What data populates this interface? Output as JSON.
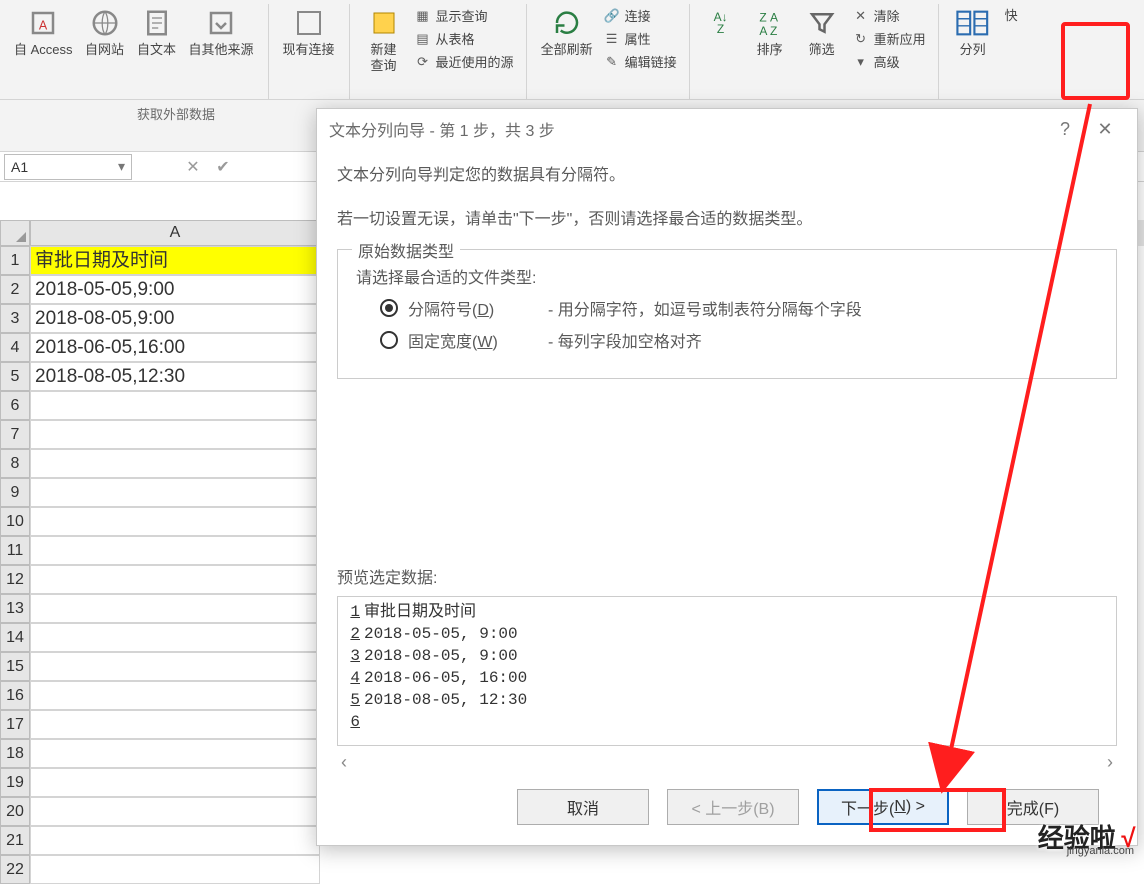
{
  "ribbon": {
    "get_external": {
      "access": "自 Access",
      "web": "自网站",
      "text": "自文本",
      "other": "自其他来源",
      "existing": "现有连接",
      "group_label": "获取外部数据"
    },
    "query": {
      "new_query": "新建\n查询",
      "show_query": "显示查询",
      "from_table": "从表格",
      "recent": "最近使用的源"
    },
    "connections": {
      "refresh_all": "全部刷新",
      "connections": "连接",
      "properties": "属性",
      "edit_links": "编辑链接"
    },
    "sort_filter": {
      "sort": "排序",
      "filter": "筛选",
      "clear": "清除",
      "reapply": "重新应用",
      "advanced": "高级"
    },
    "data_tools": {
      "text_to_columns": "分列",
      "quick": "快"
    }
  },
  "namebox": {
    "ref": "A1"
  },
  "sheet": {
    "col_header": "A",
    "header_cell": "审批日期及时间",
    "rows": [
      "2018-05-05,9:00",
      "2018-08-05,9:00",
      "2018-06-05,16:00",
      "2018-08-05,12:30"
    ]
  },
  "dialog": {
    "title": "文本分列向导 - 第 1 步，共 3 步",
    "help": "?",
    "intro1": "文本分列向导判定您的数据具有分隔符。",
    "intro2": "若一切设置无误，请单击\"下一步\"，否则请选择最合适的数据类型。",
    "orig_type": "原始数据类型",
    "choose": "请选择最合适的文件类型:",
    "radio1_label": "分隔符号(D)",
    "radio1_desc": "- 用分隔字符，如逗号或制表符分隔每个字段",
    "radio2_label": "固定宽度(W)",
    "radio2_desc": "- 每列字段加空格对齐",
    "preview_label": "预览选定数据:",
    "preview_rows": [
      "审批日期及时间",
      "2018-05-05, 9:00",
      "2018-08-05, 9:00",
      "2018-06-05, 16:00",
      "2018-08-05, 12:30",
      ""
    ],
    "buttons": {
      "cancel": "取消",
      "back": "< 上一步(B)",
      "next": "下一步(N) >",
      "finish": "完成(F)"
    }
  },
  "watermark": {
    "text": "经验啦",
    "url": "jingyanla.com"
  }
}
